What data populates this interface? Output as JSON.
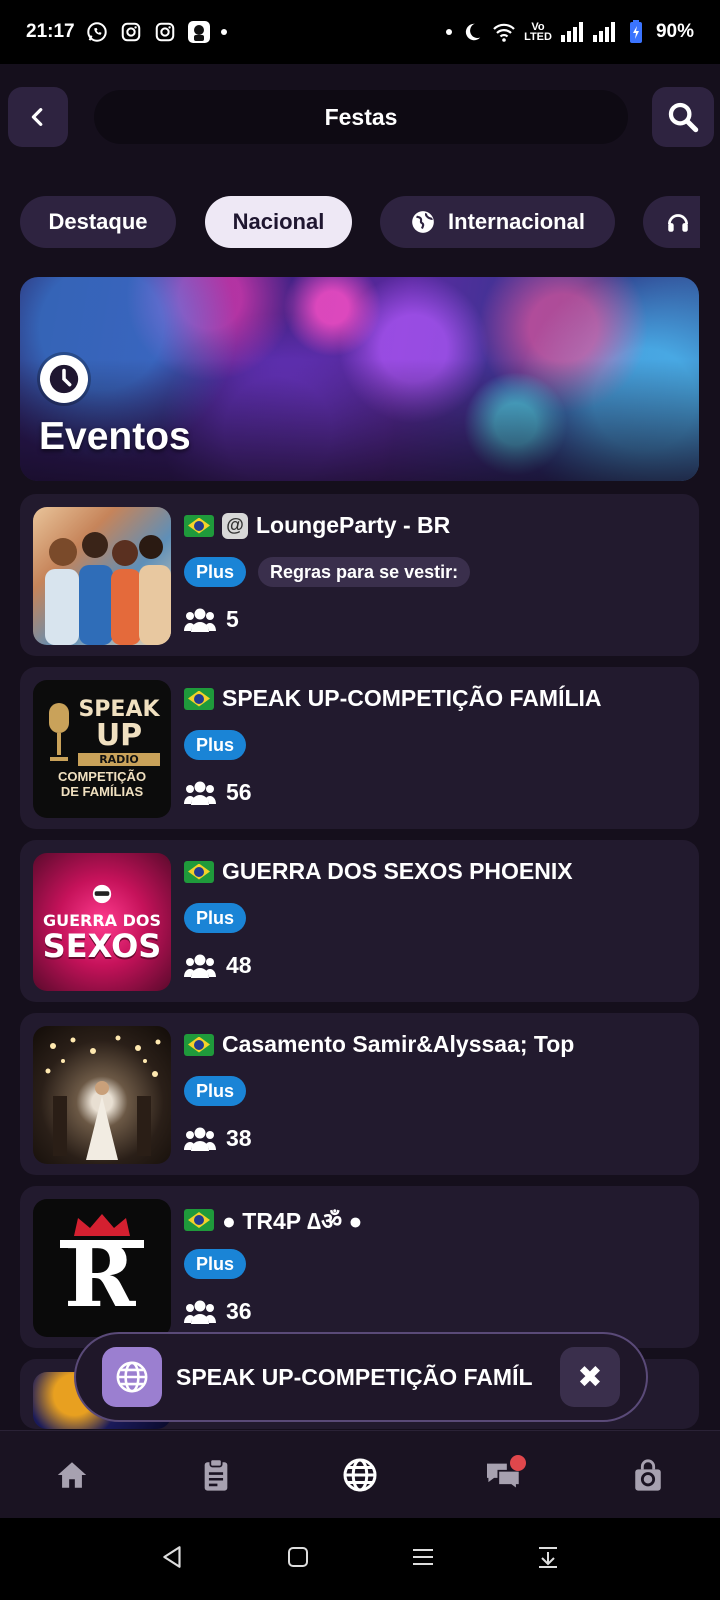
{
  "status_bar": {
    "time": "21:17",
    "volte_top": "Vo",
    "volte_bottom": "LTED",
    "battery": "90%",
    "left_icons": [
      "whatsapp-icon",
      "instagram-icon",
      "instagram-icon",
      "app-icon"
    ],
    "right_icons": [
      "moon-icon",
      "wifi-icon",
      "signal-icon",
      "signal-icon",
      "battery-icon"
    ]
  },
  "header": {
    "title": "Festas"
  },
  "tabs": [
    {
      "label": "Destaque",
      "active": false
    },
    {
      "label": "Nacional",
      "active": true
    },
    {
      "label": "Internacional",
      "active": false,
      "icon": "globe-icon"
    },
    {
      "label": "",
      "active": false,
      "icon": "headphones-icon"
    }
  ],
  "banner": {
    "title": "Eventos",
    "icon": "clock-icon"
  },
  "events": [
    {
      "title": "LoungeParty - BR",
      "badges": [
        "Plus",
        "Regras para se vestir:"
      ],
      "members": "5",
      "extra_icon": "lounge-icon"
    },
    {
      "title": "SPEAK UP-COMPETIÇÃO FAMÍLIA",
      "badges": [
        "Plus"
      ],
      "members": "56",
      "thumb_text": [
        "SPEAK",
        "UP",
        "RADIO",
        "COMPETIÇÃO",
        "DE FAMÍLIAS"
      ]
    },
    {
      "title": "GUERRA DOS SEXOS PHOENIX",
      "badges": [
        "Plus"
      ],
      "members": "48",
      "thumb_text": [
        "GUERRA DOS",
        "SEXOS"
      ]
    },
    {
      "title": "Casamento Samir&Alyssaa; Top",
      "badges": [
        "Plus"
      ],
      "members": "38"
    },
    {
      "title": "● TR4P ∆ॐ ●",
      "badges": [
        "Plus"
      ],
      "members": "36",
      "thumb_text": [
        "R"
      ]
    }
  ],
  "mini_player": {
    "title": "SPEAK UP-COMPETIÇÃO FAMÍL",
    "close": "✖"
  },
  "bottom_nav": [
    "home-icon",
    "clipboard-icon",
    "globe-icon",
    "chat-icon",
    "shop-icon"
  ],
  "colors": {
    "background": "#150f1c",
    "card": "#221a2e",
    "plus_badge": "#1a84d6",
    "tab_active": "#eee8f5",
    "tab": "#2e2340"
  }
}
